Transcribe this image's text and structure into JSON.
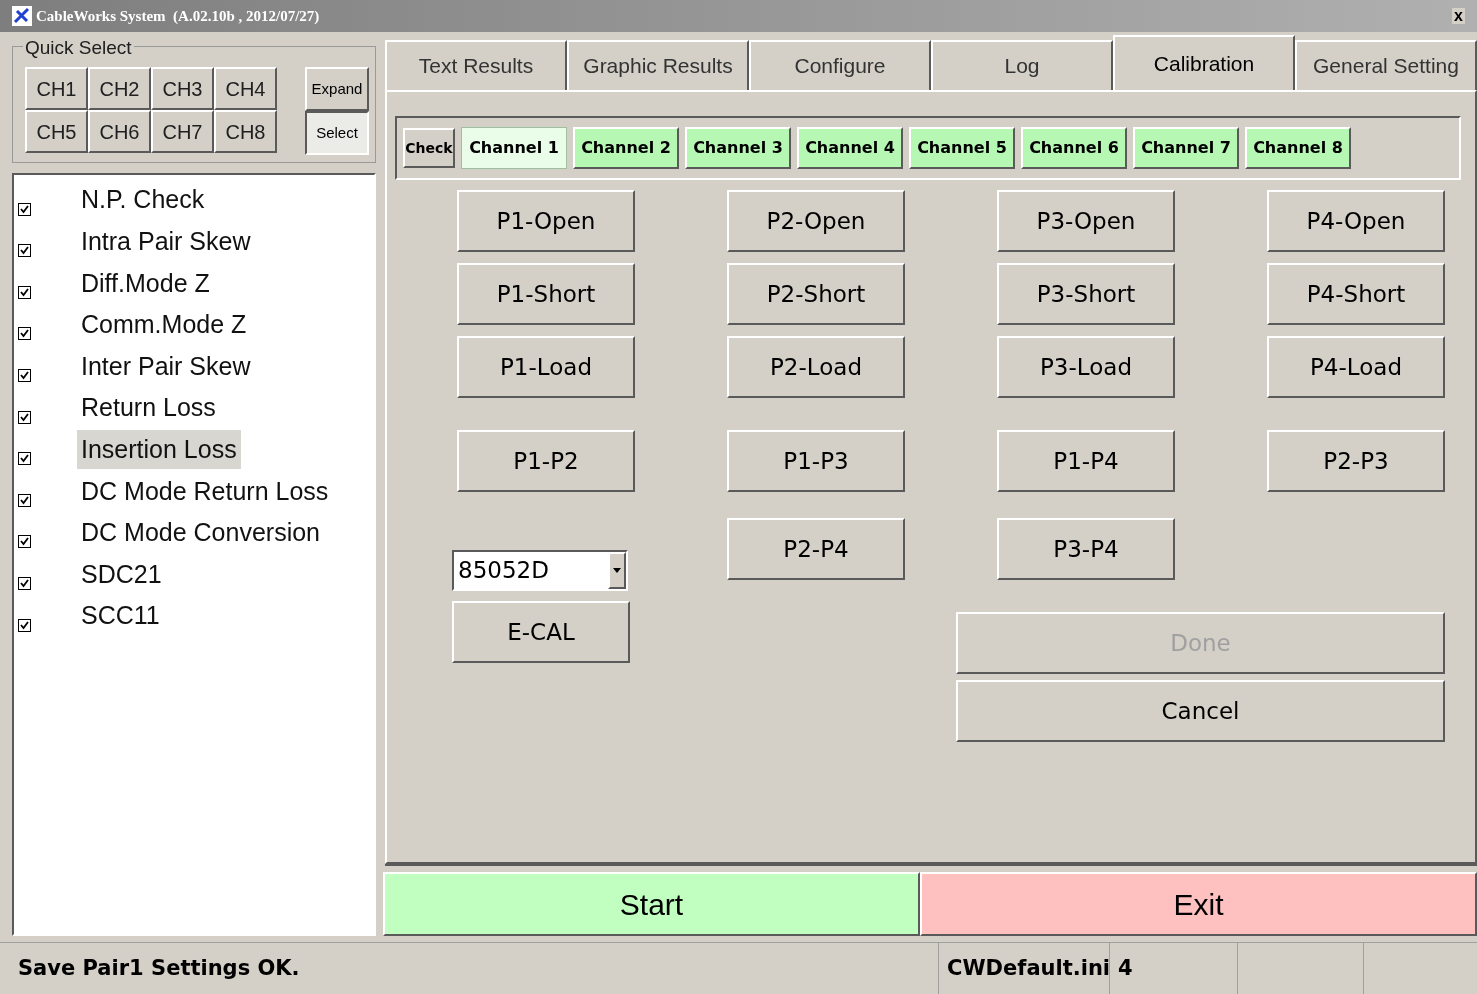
{
  "window": {
    "title": "CableWorks System  (A.02.10b , 2012/07/27)",
    "close": "x"
  },
  "quick_select": {
    "title": "Quick Select",
    "channels": [
      "CH1",
      "CH2",
      "CH3",
      "CH4",
      "CH5",
      "CH6",
      "CH7",
      "CH8"
    ],
    "modes": [
      {
        "label": "Expand",
        "selected": false
      },
      {
        "label": "Select",
        "selected": true
      }
    ]
  },
  "tests": [
    {
      "label": "N.P. Check",
      "checked": true,
      "selected": false
    },
    {
      "label": "Intra Pair Skew",
      "checked": true,
      "selected": false
    },
    {
      "label": "Diff.Mode Z",
      "checked": true,
      "selected": false
    },
    {
      "label": "Comm.Mode Z",
      "checked": true,
      "selected": false
    },
    {
      "label": "Inter Pair Skew",
      "checked": true,
      "selected": false
    },
    {
      "label": "Return Loss",
      "checked": true,
      "selected": false
    },
    {
      "label": "Insertion Loss",
      "checked": true,
      "selected": true
    },
    {
      "label": "DC Mode Return Loss",
      "checked": true,
      "selected": false
    },
    {
      "label": "DC Mode Conversion",
      "checked": true,
      "selected": false
    },
    {
      "label": "SDC21",
      "checked": true,
      "selected": false
    },
    {
      "label": "SCC11",
      "checked": true,
      "selected": false
    }
  ],
  "tabs": [
    {
      "label": "Text Results",
      "selected": false
    },
    {
      "label": "Graphic Results",
      "selected": false
    },
    {
      "label": "Configure",
      "selected": false
    },
    {
      "label": "Log",
      "selected": false
    },
    {
      "label": "Calibration",
      "selected": true
    },
    {
      "label": "General Setting",
      "selected": false
    }
  ],
  "calibration": {
    "check_button": "Check",
    "channels": [
      {
        "label": "Channel 1",
        "selected": true
      },
      {
        "label": "Channel 2",
        "selected": false
      },
      {
        "label": "Channel 3",
        "selected": false
      },
      {
        "label": "Channel 4",
        "selected": false
      },
      {
        "label": "Channel 5",
        "selected": false
      },
      {
        "label": "Channel 6",
        "selected": false
      },
      {
        "label": "Channel 7",
        "selected": false
      },
      {
        "label": "Channel 8",
        "selected": false
      }
    ],
    "standards": [
      [
        "P1-Open",
        "P2-Open",
        "P3-Open",
        "P4-Open"
      ],
      [
        "P1-Short",
        "P2-Short",
        "P3-Short",
        "P4-Short"
      ],
      [
        "P1-Load",
        "P2-Load",
        "P3-Load",
        "P4-Load"
      ]
    ],
    "thru": [
      "P1-P2",
      "P1-P3",
      "P1-P4",
      "P2-P3"
    ],
    "thru_extra": [
      "P2-P4",
      "P3-P4"
    ],
    "ecal_kit": "85052D",
    "ecal_button": "E-CAL",
    "done": {
      "label": "Done",
      "disabled": true
    },
    "cancel": {
      "label": "Cancel",
      "disabled": false
    }
  },
  "start": "Start",
  "exit": "Exit",
  "status_bar": {
    "message": "Save Pair1 Settings OK.",
    "file": "CWDefault.ini",
    "count": "4"
  }
}
